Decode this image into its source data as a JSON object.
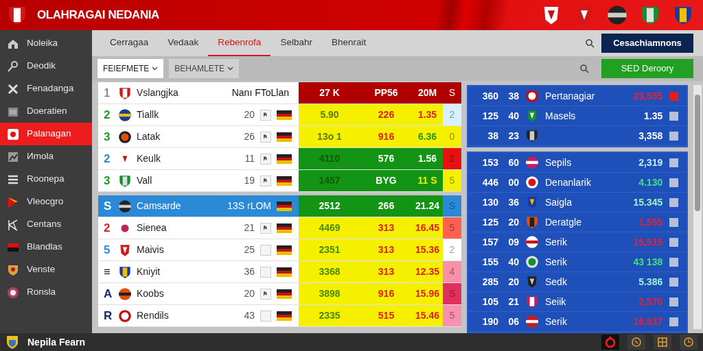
{
  "header": {
    "title": "OLAHRAGAI NEDANIA"
  },
  "sidebar": {
    "items": [
      {
        "label": "Noleika",
        "selected": false
      },
      {
        "label": "Deodik",
        "selected": false
      },
      {
        "label": "Fenadanga",
        "selected": false
      },
      {
        "label": "Doeratien",
        "selected": false
      },
      {
        "label": "Palanagan",
        "selected": true
      },
      {
        "label": "Иmola",
        "selected": false
      },
      {
        "label": "Rooпepa",
        "selected": false
      },
      {
        "label": "Vleocgro",
        "selected": false
      },
      {
        "label": "Centans",
        "selected": false
      },
      {
        "label": "Blandlas",
        "selected": false
      },
      {
        "label": "Venste",
        "selected": false
      },
      {
        "label": "Ronsla",
        "selected": false
      }
    ]
  },
  "tabs": [
    {
      "label": "Cerragaa",
      "selected": false
    },
    {
      "label": "Vedaak",
      "selected": false
    },
    {
      "label": "Rebenrofa",
      "selected": true
    },
    {
      "label": "Selbahr",
      "selected": false
    },
    {
      "label": "Bhenrait",
      "selected": false
    }
  ],
  "toolbar": {
    "action_button": "Cesachiamnons",
    "filters": [
      {
        "label": "FEIEFMETE",
        "selected": true
      },
      {
        "label": "BEHAMLETE",
        "selected": false
      }
    ],
    "filter_button": "SED Deroory"
  },
  "standings": {
    "groups": [
      {
        "rows": [
          {
            "kind": "header",
            "rank": {
              "value": "1"
            },
            "name": "Vslangjka",
            "label": "Nanı FToLlan",
            "stats": [
              {
                "value": "27 K"
              },
              {
                "value": "PP56"
              },
              {
                "value": "20M"
              }
            ],
            "s": {
              "value": "S",
              "color": "#b00000"
            }
          },
          {
            "kind": "team",
            "selected": false,
            "rank": {
              "value": "2",
              "color": "#1f9a1f"
            },
            "name": "Tiallk",
            "number": "20",
            "starred": true,
            "band": {
              "color": "#f5ef00"
            },
            "stats": [
              {
                "value": "5.90",
                "color": "#5a7a00"
              },
              {
                "value": "226",
                "color": "#e02020"
              },
              {
                "value": "1.35",
                "color": "#e02020"
              }
            ],
            "s": {
              "value": "2",
              "color": "#d8f0ff"
            }
          },
          {
            "kind": "team",
            "selected": false,
            "rank": {
              "value": "3",
              "color": "#1f9a1f"
            },
            "name": "Latak",
            "number": "26",
            "starred": true,
            "band": {
              "color": "#f5ef00"
            },
            "stats": [
              {
                "value": "13o 1",
                "color": "#5a7a00"
              },
              {
                "value": "916",
                "color": "#e02020"
              },
              {
                "value": "6.36",
                "color": "#1f9a1f"
              }
            ],
            "s": {
              "value": "0",
              "color": "#f5ef00"
            }
          },
          {
            "kind": "team",
            "selected": false,
            "rank": {
              "value": "2",
              "color": "#2a8ad8"
            },
            "name": "Keulk",
            "number": "11",
            "starred": true,
            "band": {
              "color": "#149414"
            },
            "stats": [
              {
                "value": "4110",
                "color": "#0a5a0a"
              },
              {
                "value": "576",
                "color": "#ffffff"
              },
              {
                "value": "1.56",
                "color": "#ffffff"
              }
            ],
            "s": {
              "value": "2",
              "color": "#e81010"
            }
          },
          {
            "kind": "team",
            "selected": false,
            "rank": {
              "value": "3",
              "color": "#1f9a1f"
            },
            "name": "Vall",
            "number": "19",
            "starred": true,
            "band": {
              "color": "#149414"
            },
            "stats": [
              {
                "value": "1457",
                "color": "#0a5a0a"
              },
              {
                "value": "BYG",
                "color": "#ffffff"
              },
              {
                "value": "11 S",
                "color": "#f5ef00"
              }
            ],
            "s": {
              "value": "5",
              "color": "#f5ef00"
            }
          }
        ]
      },
      {
        "rows": [
          {
            "kind": "team",
            "selected": true,
            "rank": {
              "value": "S",
              "color": "#ffffff"
            },
            "name": "Camsarde",
            "number": "13S rLOM",
            "band": {
              "color": "#149414"
            },
            "stats": [
              {
                "value": "2512",
                "color": "#ffffff"
              },
              {
                "value": "266",
                "color": "#ffffff"
              },
              {
                "value": "21.24",
                "color": "#ffffff"
              }
            ],
            "s": {
              "value": "S",
              "color": "#2a8ad8"
            }
          },
          {
            "kind": "team",
            "selected": false,
            "rank": {
              "value": "2",
              "color": "#e02020"
            },
            "name": "Sienea",
            "number": "21",
            "starred": true,
            "band": {
              "color": "#f5ef00"
            },
            "stats": [
              {
                "value": "4469",
                "color": "#4a8a00"
              },
              {
                "value": "313",
                "color": "#e02020"
              },
              {
                "value": "16.45",
                "color": "#e02020"
              }
            ],
            "s": {
              "value": "5",
              "color": "#ff6050"
            }
          },
          {
            "kind": "team",
            "selected": false,
            "rank": {
              "value": "5",
              "color": "#2a8ad8"
            },
            "name": "Maivis",
            "number": "25",
            "starred": false,
            "band": {
              "color": "#f5ef00"
            },
            "stats": [
              {
                "value": "2351",
                "color": "#4a8a00"
              },
              {
                "value": "313",
                "color": "#e02020"
              },
              {
                "value": "15.36",
                "color": "#e02020"
              }
            ],
            "s": {
              "value": "2",
              "color": "#ffffff"
            }
          },
          {
            "kind": "team",
            "selected": false,
            "rank": {
              "value": "≡",
              "color": "#1a1a2a"
            },
            "name": "Kniyit",
            "number": "36",
            "starred": false,
            "band": {
              "color": "#f5ef00"
            },
            "stats": [
              {
                "value": "3368",
                "color": "#4a8a00"
              },
              {
                "value": "313",
                "color": "#e02020"
              },
              {
                "value": "12.35",
                "color": "#e02020"
              }
            ],
            "s": {
              "value": "4",
              "color": "#f890a8"
            }
          },
          {
            "kind": "team",
            "selected": false,
            "rank": {
              "value": "A",
              "color": "#1a2a6a"
            },
            "name": "Koobs",
            "number": "20",
            "starred": true,
            "band": {
              "color": "#f5ef00"
            },
            "stats": [
              {
                "value": "3898",
                "color": "#4a8a00"
              },
              {
                "value": "916",
                "color": "#e02020"
              },
              {
                "value": "15.96",
                "color": "#e02020"
              }
            ],
            "s": {
              "value": "S",
              "color": "#e03060"
            }
          },
          {
            "kind": "team",
            "selected": false,
            "rank": {
              "value": "R",
              "color": "#1a2a6a"
            },
            "name": "Rendils",
            "number": "43",
            "starred": false,
            "band": {
              "color": "#f5ef00"
            },
            "stats": [
              {
                "value": "2335",
                "color": "#4a8a00"
              },
              {
                "value": "515",
                "color": "#e02020"
              },
              {
                "value": "15.46",
                "color": "#e02020"
              }
            ],
            "s": {
              "value": "5",
              "color": "#f890b0"
            }
          }
        ]
      }
    ]
  },
  "ranking": {
    "groups": [
      {
        "rows": [
          {
            "points": "360",
            "goals": "38",
            "name": "Pertanagiar",
            "value": "23,555",
            "color": "#e8203a",
            "checked": true
          },
          {
            "points": "125",
            "goals": "40",
            "name": "Masels",
            "value": "1.35",
            "color": "#ffffff",
            "checked": false
          },
          {
            "points": "38",
            "goals": "23",
            "value": "3,358",
            "color": "#ffffff",
            "checked": false
          }
        ]
      },
      {
        "rows": [
          {
            "points": "153",
            "goals": "60",
            "name": "Sepils",
            "value": "2,319",
            "color": "#c0f0ff",
            "checked": false
          },
          {
            "points": "446",
            "goals": "00",
            "name": "Denanlarik",
            "value": "4.130",
            "color": "#40e080",
            "checked": false
          },
          {
            "points": "130",
            "goals": "36",
            "name": "Saigla",
            "value": "15.345",
            "color": "#a0f0c8",
            "checked": false
          },
          {
            "points": "125",
            "goals": "20",
            "name": "Deratgle",
            "value": "1,555",
            "color": "#e8203a",
            "checked": false
          },
          {
            "points": "157",
            "goals": "09",
            "name": "Serik",
            "value": "15,515",
            "color": "#e8203a",
            "checked": false
          },
          {
            "points": "155",
            "goals": "40",
            "name": "Serik",
            "value": "43 138",
            "color": "#40e080",
            "checked": false
          },
          {
            "points": "285",
            "goals": "20",
            "name": "Sedk",
            "value": "5.386",
            "color": "#a0f0e0",
            "checked": false
          },
          {
            "points": "105",
            "goals": "21",
            "name": "Seiik",
            "value": "2,570",
            "color": "#e8203a",
            "checked": false
          },
          {
            "points": "190",
            "goals": "06",
            "name": "Serik",
            "value": "16,537",
            "color": "#e8203a",
            "checked": false
          }
        ]
      }
    ]
  },
  "footer": {
    "team": "Nepila Fearn"
  }
}
